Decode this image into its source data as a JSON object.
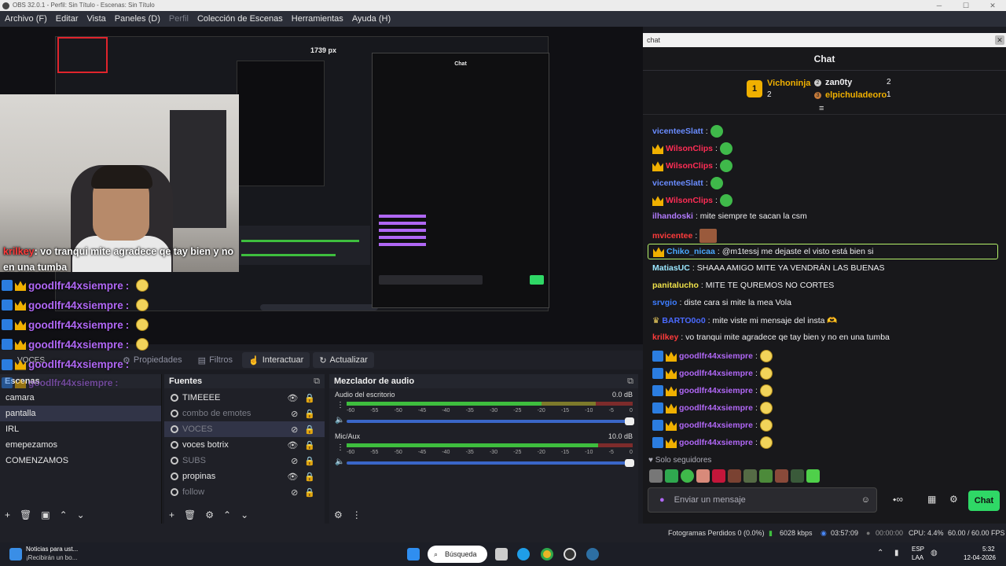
{
  "window": {
    "title": "OBS 32.0.1 - Perfil: Sin Título - Escenas: Sin Título",
    "controls": [
      "─",
      "☐",
      "✕"
    ]
  },
  "menu": [
    "Archivo (F)",
    "Editar",
    "Vista",
    "Paneles (D)",
    "Perfil",
    "Colección de Escenas",
    "Herramientas",
    "Ayuda (H)"
  ],
  "preview": {
    "width_label": "1739 px",
    "nested_title": "Chat",
    "overlay_message": {
      "name": "krilkey",
      "text": ": vo tranqui mite agradece qe tay bien y no en una tumba",
      "name_color": "#ff3b3b"
    },
    "overlay_rows": [
      {
        "name": "goodlfr44xsiempre",
        "suffix": " :"
      },
      {
        "name": "goodlfr44xsiempre",
        "suffix": " :"
      },
      {
        "name": "goodlfr44xsiempre",
        "suffix": " :"
      },
      {
        "name": "goodlfr44xsiempre",
        "suffix": " :"
      },
      {
        "name": "goodlfr44xsiempre",
        "suffix": " :"
      },
      {
        "name": "goodlfr44xsiempre",
        "suffix": " :"
      }
    ],
    "voices_label": "VOCES"
  },
  "preview_toolbar": {
    "properties": "Propiedades",
    "filters": "Filtros",
    "interact": "Interactuar",
    "refresh": "Actualizar"
  },
  "scenes": {
    "title": "Escenas",
    "items": [
      "camara",
      "pantalla",
      "IRL",
      "emepezamos",
      "COMENZAMOS"
    ],
    "selected": "pantalla"
  },
  "sources": {
    "title": "Fuentes",
    "items": [
      {
        "name": "TIMEEEE",
        "visible": true
      },
      {
        "name": "combo de emotes",
        "visible": false
      },
      {
        "name": "VOCES",
        "visible": false
      },
      {
        "name": "voces botrix",
        "visible": true
      },
      {
        "name": "SUBS",
        "visible": false
      },
      {
        "name": "propinas",
        "visible": true
      },
      {
        "name": "follow",
        "visible": false
      }
    ]
  },
  "mixer": {
    "title": "Mezclador de audio",
    "channels": [
      {
        "name": "Audio del escritorio",
        "db": "0.0 dB",
        "level": 0.68,
        "fader": 1.0
      },
      {
        "name": "Mic/Aux",
        "db": "10.0 dB",
        "level": 0.88,
        "fader": 1.0
      }
    ],
    "scale": [
      "-60",
      "-55",
      "-50",
      "-45",
      "-40",
      "-35",
      "-30",
      "-25",
      "-20",
      "-15",
      "-10",
      "-5",
      "0"
    ]
  },
  "chat": {
    "window_title": "chat",
    "header": "Chat",
    "leaders": [
      {
        "name": "Vichoninja",
        "count": "2",
        "rank": "1"
      },
      {
        "name": "zan0ty",
        "count": "2",
        "rank": "2"
      },
      {
        "name": "elpichuladeoro",
        "count": "1",
        "rank": "3"
      }
    ],
    "messages": [
      {
        "name": "vicenteeSlatt",
        "color": "#6a8cff",
        "text": ":",
        "badge": "",
        "emote": "🐸"
      },
      {
        "name": "WilsonClips",
        "color": "#ff2d55",
        "text": ":",
        "badge": "crown",
        "emote": "🟢"
      },
      {
        "name": "WilsonClips",
        "color": "#ff2d55",
        "text": ":",
        "badge": "crown",
        "emote": "🟢"
      },
      {
        "name": "vicenteeSlatt",
        "color": "#6a8cff",
        "text": ":",
        "badge": "",
        "emote": "🐸"
      },
      {
        "name": "WilsonClips",
        "color": "#ff2d55",
        "text": ":",
        "badge": "crown",
        "emote": "🟢"
      },
      {
        "name": "ilhandoski",
        "color": "#b27bff",
        "text": ": mite siempre te sacan la csm",
        "badge": "",
        "emote": ""
      },
      {
        "name": "mvicentee",
        "color": "#ff3b3b",
        "text": ":",
        "badge": "",
        "emote": "🙂"
      },
      {
        "name": "Chiko_nicaa",
        "color": "#4aa8ff",
        "text": ": @m1tessj me dejaste el visto está bien si",
        "badge": "crown",
        "emote": "",
        "highlight": true
      },
      {
        "name": "MatiasUC",
        "color": "#9be7ff",
        "text": ": SHAAA AMIGO MITE YA VENDRÁN LAS BUENAS",
        "badge": "",
        "emote": ""
      },
      {
        "name": "panitalucho",
        "color": "#f0e24a",
        "text": ": MITE TE QUREMOS NO CORTES",
        "badge": "",
        "emote": ""
      },
      {
        "name": "srvgio",
        "color": "#3d7dff",
        "text": ": diste cara si mite la mea Vola",
        "badge": "",
        "emote": ""
      },
      {
        "name": "BARTO0o0",
        "color": "#4a6aff",
        "text": ": mite viste mi mensaje del insta 🫶",
        "badge": "",
        "emote": ""
      },
      {
        "name": "krilkey",
        "color": "#ff3b3b",
        "text": ": vo tranqui mite agradece qe tay bien y no en una tumba",
        "badge": "",
        "emote": ""
      },
      {
        "name": "goodlfr44xsiempre",
        "color": "#b067f5",
        "text": ":",
        "badge": "both",
        "emote": "😄"
      },
      {
        "name": "goodlfr44xsiempre",
        "color": "#b067f5",
        "text": ":",
        "badge": "both",
        "emote": "😄"
      },
      {
        "name": "goodlfr44xsiempre",
        "color": "#b067f5",
        "text": ":",
        "badge": "both",
        "emote": "😄"
      },
      {
        "name": "goodlfr44xsiempre",
        "color": "#b067f5",
        "text": ":",
        "badge": "both",
        "emote": "😄"
      },
      {
        "name": "goodlfr44xsiempre",
        "color": "#b067f5",
        "text": ":",
        "badge": "both",
        "emote": "😄"
      },
      {
        "name": "goodlfr44xsiempre",
        "color": "#b067f5",
        "text": ":",
        "badge": "both",
        "emote": "😄"
      }
    ],
    "followers_only": "Solo seguidores",
    "input_placeholder": "Enviar un mensaje",
    "send_button": "Chat",
    "accent": "#2fd866"
  },
  "status": {
    "dropped": "Fotogramas Perdidos 0 (0.0%)",
    "bitrate": "6028 kbps",
    "live_time": "03:57:09",
    "rec_time": "00:00:00",
    "cpu": "CPU: 4.4%",
    "fps": "60.00 / 60.00 FPS"
  },
  "taskbar": {
    "news_title": "Noticias para ust...",
    "news_sub": "¡Recibirán un bo...",
    "search": "Búsqueda",
    "lang": "ESP",
    "lang2": "LAA",
    "time": "5:32",
    "date": "12-04-2026"
  }
}
